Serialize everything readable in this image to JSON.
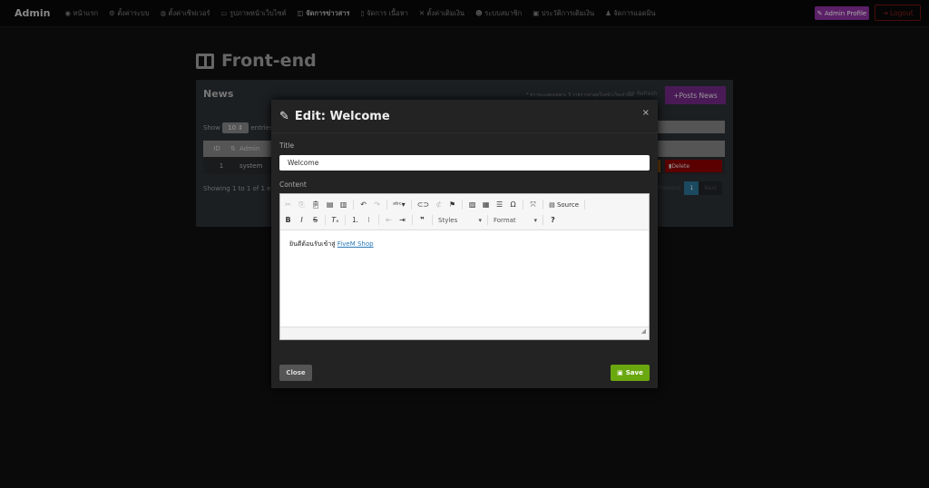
{
  "nav": {
    "brand": "Admin",
    "items": [
      {
        "label": "หน้าแรก",
        "icon": "dashboard-icon"
      },
      {
        "label": "ตั้งค่าระบบ",
        "icon": "cogs-icon"
      },
      {
        "label": "ตั้งค่าเซิฟเวอร์",
        "icon": "gamepad-icon"
      },
      {
        "label": "รูปภาพหน้าเว็บไซต์",
        "icon": "desktop-icon"
      },
      {
        "label": "จัดการข่าวสาร",
        "icon": "columns-icon",
        "active": true
      },
      {
        "label": "จัดการ เนื้อหา",
        "icon": "file-icon"
      },
      {
        "label": "ตั้งค่าเติมเงิน",
        "icon": "tools-icon"
      },
      {
        "label": "ระบบสมาชิก",
        "icon": "users-icon"
      },
      {
        "label": "ประวัติการเติมเงิน",
        "icon": "history-icon"
      },
      {
        "label": "จัดการแอดมิน",
        "icon": "user-icon"
      }
    ],
    "admin_profile": "Admin Profile",
    "logout": "Logout"
  },
  "page": {
    "title": "Front-end"
  },
  "panel": {
    "title": "News",
    "note": "* ข่าวจะแสดงเฉพาะ 5 รายการล่าสุดในหน้าเว็บเท่านั้น",
    "refresh": "Refresh",
    "posts_news": "Posts News",
    "show": "Show",
    "entries_value": "10",
    "entries": "entries",
    "columns": [
      "ID",
      "Admin"
    ],
    "rows": [
      {
        "id": "1",
        "admin": "system",
        "delete": "Delete"
      }
    ],
    "showing": "Showing 1 to 1 of 1 entries",
    "previous": "Previous",
    "page": "1",
    "next": "Next"
  },
  "modal": {
    "title": "Edit: Welcome",
    "close_x": "×",
    "title_label": "Title",
    "title_value": "Welcome",
    "content_label": "Content",
    "toolbar": {
      "source": "Source",
      "styles": "Styles",
      "format": "Format",
      "help": "?"
    },
    "content_text": "ยินดีต้อนรับเข้าสู่ ",
    "content_link": "FiveM Shop",
    "close": "Close",
    "save": "Save"
  }
}
